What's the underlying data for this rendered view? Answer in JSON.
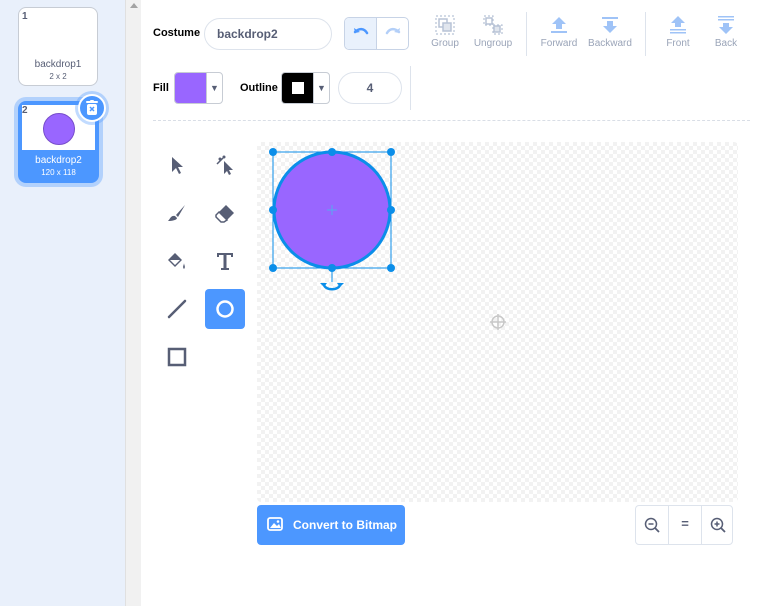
{
  "costumes": [
    {
      "number": "1",
      "name": "backdrop1",
      "size": "2 x 2",
      "selected": false
    },
    {
      "number": "2",
      "name": "backdrop2",
      "size": "120 x 118",
      "selected": true,
      "thumb_color": "#9966ff"
    }
  ],
  "toolbar": {
    "costume_label": "Costume",
    "costume_name": "backdrop2",
    "group_label": "Group",
    "ungroup_label": "Ungroup",
    "forward_label": "Forward",
    "backward_label": "Backward",
    "front_label": "Front",
    "back_label": "Back",
    "fill_label": "Fill",
    "outline_label": "Outline",
    "fill_color": "#9966ff",
    "outline_color": "#000000",
    "stroke_width": "4"
  },
  "tools": [
    {
      "name": "select",
      "active": false
    },
    {
      "name": "reshape",
      "active": false
    },
    {
      "name": "brush",
      "active": false
    },
    {
      "name": "eraser",
      "active": false
    },
    {
      "name": "fill",
      "active": false
    },
    {
      "name": "text",
      "active": false
    },
    {
      "name": "line",
      "active": false
    },
    {
      "name": "circle",
      "active": true
    },
    {
      "name": "rectangle",
      "active": false
    }
  ],
  "canvas": {
    "shape": "circle",
    "shape_fill": "#9966ff",
    "selection_color": "#0b8ee9"
  },
  "convert_button_label": "Convert to Bitmap",
  "zoom": {
    "zoom_out": "zoom-out-icon",
    "reset": "=",
    "zoom_in": "zoom-in-icon"
  },
  "colors": {
    "accent": "#4c97ff",
    "sidebar_bg": "#e9f0fb"
  }
}
